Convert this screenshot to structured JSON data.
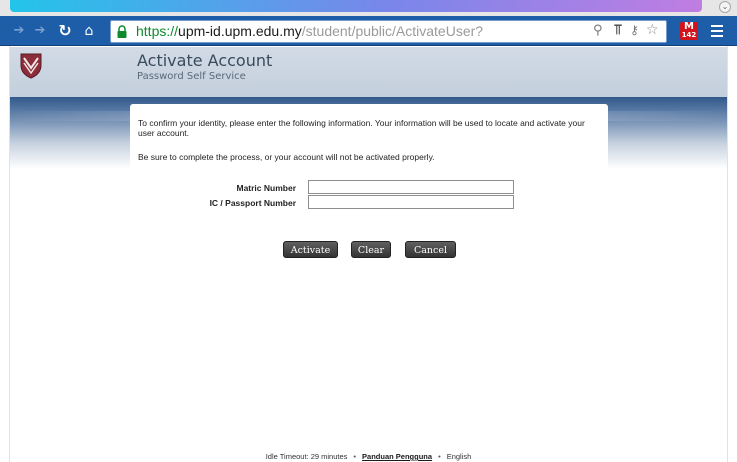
{
  "browser": {
    "url_scheme": "https://",
    "url_host": "upm-id.upm.edu.my",
    "url_path": "/student/public/ActivateUser?",
    "extension_badge": "M",
    "extension_count": "142"
  },
  "header": {
    "title": "Activate Account",
    "subtitle": "Password Self Service"
  },
  "form": {
    "intro": "To confirm your identity, please enter the following information. Your information will be used to locate and activate your user account.",
    "warning": "Be sure to complete the process, or your account will not be activated properly.",
    "matric_label": "Matric Number",
    "matric_value": "",
    "ic_label": "IC / Passport Number",
    "ic_value": "",
    "buttons": {
      "activate": "Activate",
      "clear": "Clear",
      "cancel": "Cancel"
    }
  },
  "footer": {
    "idle_timeout": "Idle Timeout: 29 minutes",
    "separator": "•",
    "guide_link": "Panduan Pengguna",
    "language": "English"
  }
}
